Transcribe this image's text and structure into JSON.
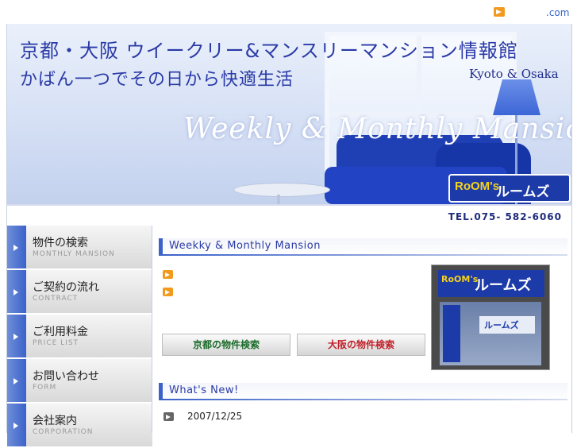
{
  "topbar": {
    "link_text": ".com"
  },
  "hero": {
    "title_line1": "京都・大阪 ウイークリー&マンスリーマンション情報館",
    "title_line2": "かばん一つでその日から快適生活",
    "subtitle_en": "Kyoto & Osaka",
    "tagline": "Weekly & Monthly Mansion",
    "logo_brand": "RoOM's",
    "logo_name": "ルームズ"
  },
  "tel": "TEL.075- 582-6060",
  "sidebar": {
    "items": [
      {
        "jp": "物件の検索",
        "en": "MONTHLY MANSION"
      },
      {
        "jp": "ご契約の流れ",
        "en": "CONTRACT"
      },
      {
        "jp": "ご利用料金",
        "en": "PRICE LIST"
      },
      {
        "jp": "お問い合わせ",
        "en": "FORM"
      },
      {
        "jp": "会社案内",
        "en": "CORPORATION"
      }
    ]
  },
  "main": {
    "section1_title": "Weekky & Monthly Mansion",
    "btn_kyoto": "京都の物件検索",
    "btn_osaka": "大阪の物件検索",
    "photo_sign_brand": "RoOM's",
    "photo_sign_name": "ルームズ",
    "photo_small": "ルームズ",
    "section2_title": "What's New!",
    "news": [
      {
        "date": "2007/12/25"
      }
    ]
  },
  "colors": {
    "accent": "#3b62c9",
    "brand": "#1c3aa8",
    "arrow": "#f29a1f",
    "title": "#2a3aa6"
  }
}
